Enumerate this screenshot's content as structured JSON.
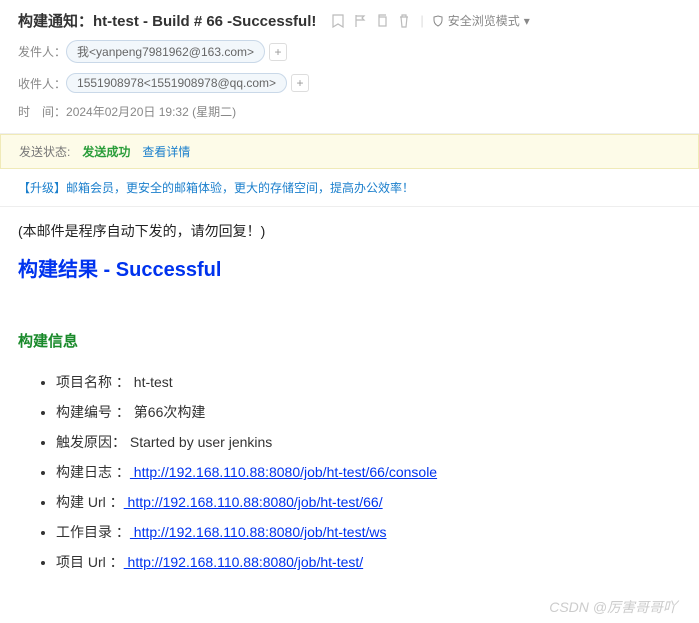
{
  "header": {
    "subject": "构建通知：ht-test - Build # 66 -Successful!",
    "safe_mode": "安全浏览模式",
    "from_label": "发件人：",
    "from_chip": "我<yanpeng7981962@163.com>",
    "to_label": "收件人：",
    "to_chip": "1551908978<1551908978@qq.com>",
    "time_label": "时　间：",
    "time_value": "2024年02月20日 19:32 (星期二)"
  },
  "status": {
    "label": "发送状态:",
    "value": "发送成功",
    "detail_link": "查看详情"
  },
  "upgrade": {
    "text": "【升级】邮箱会员，更安全的邮箱体验，更大的存储空间，提高办公效率！"
  },
  "body": {
    "no_reply": "(本邮件是程序自动下发的，请勿回复！)",
    "result_title": "构建结果 - Successful",
    "section_title": "构建信息",
    "items": [
      {
        "label": "项目名称 ：",
        "value": " ht-test",
        "is_link": false
      },
      {
        "label": "构建编号 ：",
        "value": " 第66次构建",
        "is_link": false
      },
      {
        "label": "触发原因：",
        "value": " Started by user jenkins",
        "is_link": false
      },
      {
        "label": "构建日志 ：",
        "value": " http://192.168.110.88:8080/job/ht-test/66/console",
        "is_link": true
      },
      {
        "label": "构建  Url ：",
        "value": " http://192.168.110.88:8080/job/ht-test/66/",
        "is_link": true
      },
      {
        "label": "工作目录 ：",
        "value": "  http://192.168.110.88:8080/job/ht-test/ws",
        "is_link": true
      },
      {
        "label": "项目  Url ：",
        "value": " http://192.168.110.88:8080/job/ht-test/",
        "is_link": true
      }
    ]
  },
  "watermark": "CSDN @厉害哥哥吖"
}
